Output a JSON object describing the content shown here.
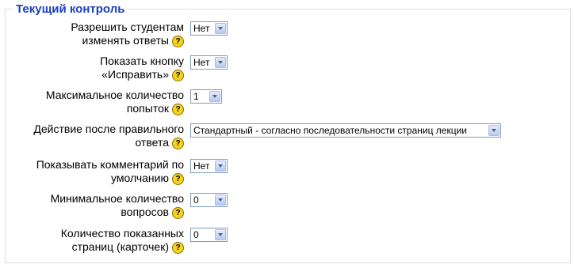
{
  "section": {
    "legend": "Текущий контроль"
  },
  "help_glyph": "?",
  "fields": {
    "allow_change": {
      "label_line1": "Разрешить студентам",
      "label_line2": "изменять ответы",
      "value": "Нет"
    },
    "show_correct": {
      "label_line1": "Показать кнопку",
      "label_line2": "«Исправить»",
      "value": "Нет"
    },
    "max_attempts": {
      "label_line1": "Максимальное количество",
      "label_line2": "попыток",
      "value": "1"
    },
    "after_correct": {
      "label_line1": "Действие после правильного",
      "label_line2": "ответа",
      "value": "Стандартный - согласно последовательности страниц лекции"
    },
    "default_feedback": {
      "label_line1": "Показывать комментарий по",
      "label_line2": "умолчанию",
      "value": "Нет"
    },
    "min_questions": {
      "label_line1": "Минимальное количество",
      "label_line2": "вопросов",
      "value": "0"
    },
    "pages_shown": {
      "label_line1": "Количество показанных",
      "label_line2": "страниц (карточек)",
      "value": "0"
    }
  }
}
